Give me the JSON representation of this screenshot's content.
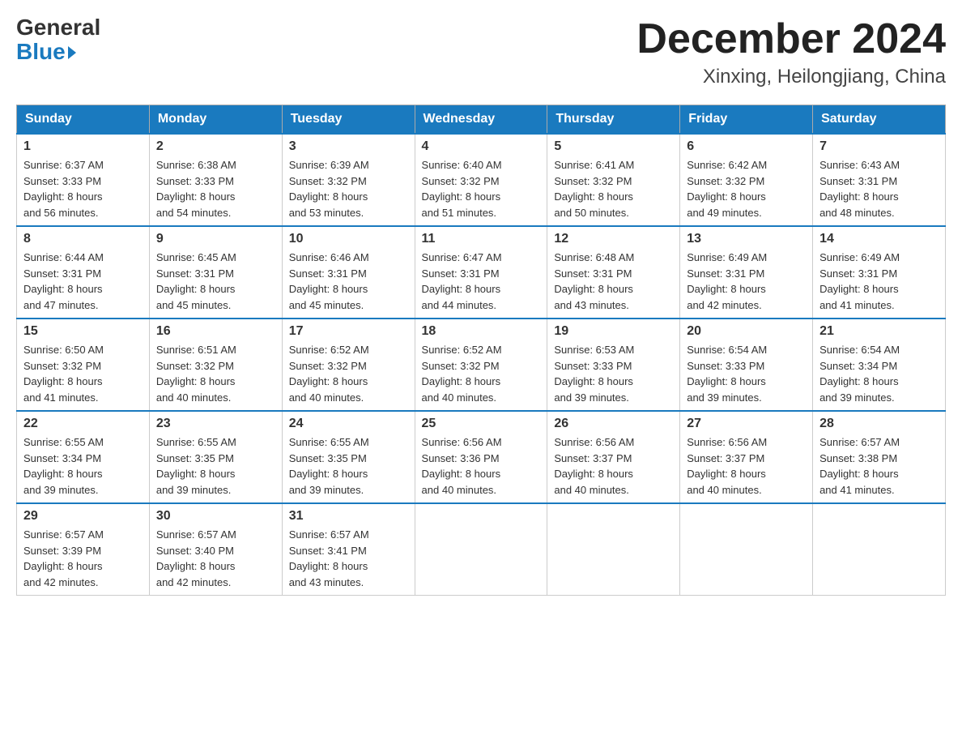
{
  "logo": {
    "general": "General",
    "blue": "Blue"
  },
  "title": "December 2024",
  "location": "Xinxing, Heilongjiang, China",
  "days_of_week": [
    "Sunday",
    "Monday",
    "Tuesday",
    "Wednesday",
    "Thursday",
    "Friday",
    "Saturday"
  ],
  "weeks": [
    [
      {
        "day": "1",
        "sunrise": "6:37 AM",
        "sunset": "3:33 PM",
        "daylight": "8 hours and 56 minutes."
      },
      {
        "day": "2",
        "sunrise": "6:38 AM",
        "sunset": "3:33 PM",
        "daylight": "8 hours and 54 minutes."
      },
      {
        "day": "3",
        "sunrise": "6:39 AM",
        "sunset": "3:32 PM",
        "daylight": "8 hours and 53 minutes."
      },
      {
        "day": "4",
        "sunrise": "6:40 AM",
        "sunset": "3:32 PM",
        "daylight": "8 hours and 51 minutes."
      },
      {
        "day": "5",
        "sunrise": "6:41 AM",
        "sunset": "3:32 PM",
        "daylight": "8 hours and 50 minutes."
      },
      {
        "day": "6",
        "sunrise": "6:42 AM",
        "sunset": "3:32 PM",
        "daylight": "8 hours and 49 minutes."
      },
      {
        "day": "7",
        "sunrise": "6:43 AM",
        "sunset": "3:31 PM",
        "daylight": "8 hours and 48 minutes."
      }
    ],
    [
      {
        "day": "8",
        "sunrise": "6:44 AM",
        "sunset": "3:31 PM",
        "daylight": "8 hours and 47 minutes."
      },
      {
        "day": "9",
        "sunrise": "6:45 AM",
        "sunset": "3:31 PM",
        "daylight": "8 hours and 45 minutes."
      },
      {
        "day": "10",
        "sunrise": "6:46 AM",
        "sunset": "3:31 PM",
        "daylight": "8 hours and 45 minutes."
      },
      {
        "day": "11",
        "sunrise": "6:47 AM",
        "sunset": "3:31 PM",
        "daylight": "8 hours and 44 minutes."
      },
      {
        "day": "12",
        "sunrise": "6:48 AM",
        "sunset": "3:31 PM",
        "daylight": "8 hours and 43 minutes."
      },
      {
        "day": "13",
        "sunrise": "6:49 AM",
        "sunset": "3:31 PM",
        "daylight": "8 hours and 42 minutes."
      },
      {
        "day": "14",
        "sunrise": "6:49 AM",
        "sunset": "3:31 PM",
        "daylight": "8 hours and 41 minutes."
      }
    ],
    [
      {
        "day": "15",
        "sunrise": "6:50 AM",
        "sunset": "3:32 PM",
        "daylight": "8 hours and 41 minutes."
      },
      {
        "day": "16",
        "sunrise": "6:51 AM",
        "sunset": "3:32 PM",
        "daylight": "8 hours and 40 minutes."
      },
      {
        "day": "17",
        "sunrise": "6:52 AM",
        "sunset": "3:32 PM",
        "daylight": "8 hours and 40 minutes."
      },
      {
        "day": "18",
        "sunrise": "6:52 AM",
        "sunset": "3:32 PM",
        "daylight": "8 hours and 40 minutes."
      },
      {
        "day": "19",
        "sunrise": "6:53 AM",
        "sunset": "3:33 PM",
        "daylight": "8 hours and 39 minutes."
      },
      {
        "day": "20",
        "sunrise": "6:54 AM",
        "sunset": "3:33 PM",
        "daylight": "8 hours and 39 minutes."
      },
      {
        "day": "21",
        "sunrise": "6:54 AM",
        "sunset": "3:34 PM",
        "daylight": "8 hours and 39 minutes."
      }
    ],
    [
      {
        "day": "22",
        "sunrise": "6:55 AM",
        "sunset": "3:34 PM",
        "daylight": "8 hours and 39 minutes."
      },
      {
        "day": "23",
        "sunrise": "6:55 AM",
        "sunset": "3:35 PM",
        "daylight": "8 hours and 39 minutes."
      },
      {
        "day": "24",
        "sunrise": "6:55 AM",
        "sunset": "3:35 PM",
        "daylight": "8 hours and 39 minutes."
      },
      {
        "day": "25",
        "sunrise": "6:56 AM",
        "sunset": "3:36 PM",
        "daylight": "8 hours and 40 minutes."
      },
      {
        "day": "26",
        "sunrise": "6:56 AM",
        "sunset": "3:37 PM",
        "daylight": "8 hours and 40 minutes."
      },
      {
        "day": "27",
        "sunrise": "6:56 AM",
        "sunset": "3:37 PM",
        "daylight": "8 hours and 40 minutes."
      },
      {
        "day": "28",
        "sunrise": "6:57 AM",
        "sunset": "3:38 PM",
        "daylight": "8 hours and 41 minutes."
      }
    ],
    [
      {
        "day": "29",
        "sunrise": "6:57 AM",
        "sunset": "3:39 PM",
        "daylight": "8 hours and 42 minutes."
      },
      {
        "day": "30",
        "sunrise": "6:57 AM",
        "sunset": "3:40 PM",
        "daylight": "8 hours and 42 minutes."
      },
      {
        "day": "31",
        "sunrise": "6:57 AM",
        "sunset": "3:41 PM",
        "daylight": "8 hours and 43 minutes."
      },
      null,
      null,
      null,
      null
    ]
  ],
  "labels": {
    "sunrise": "Sunrise:",
    "sunset": "Sunset:",
    "daylight": "Daylight:"
  }
}
